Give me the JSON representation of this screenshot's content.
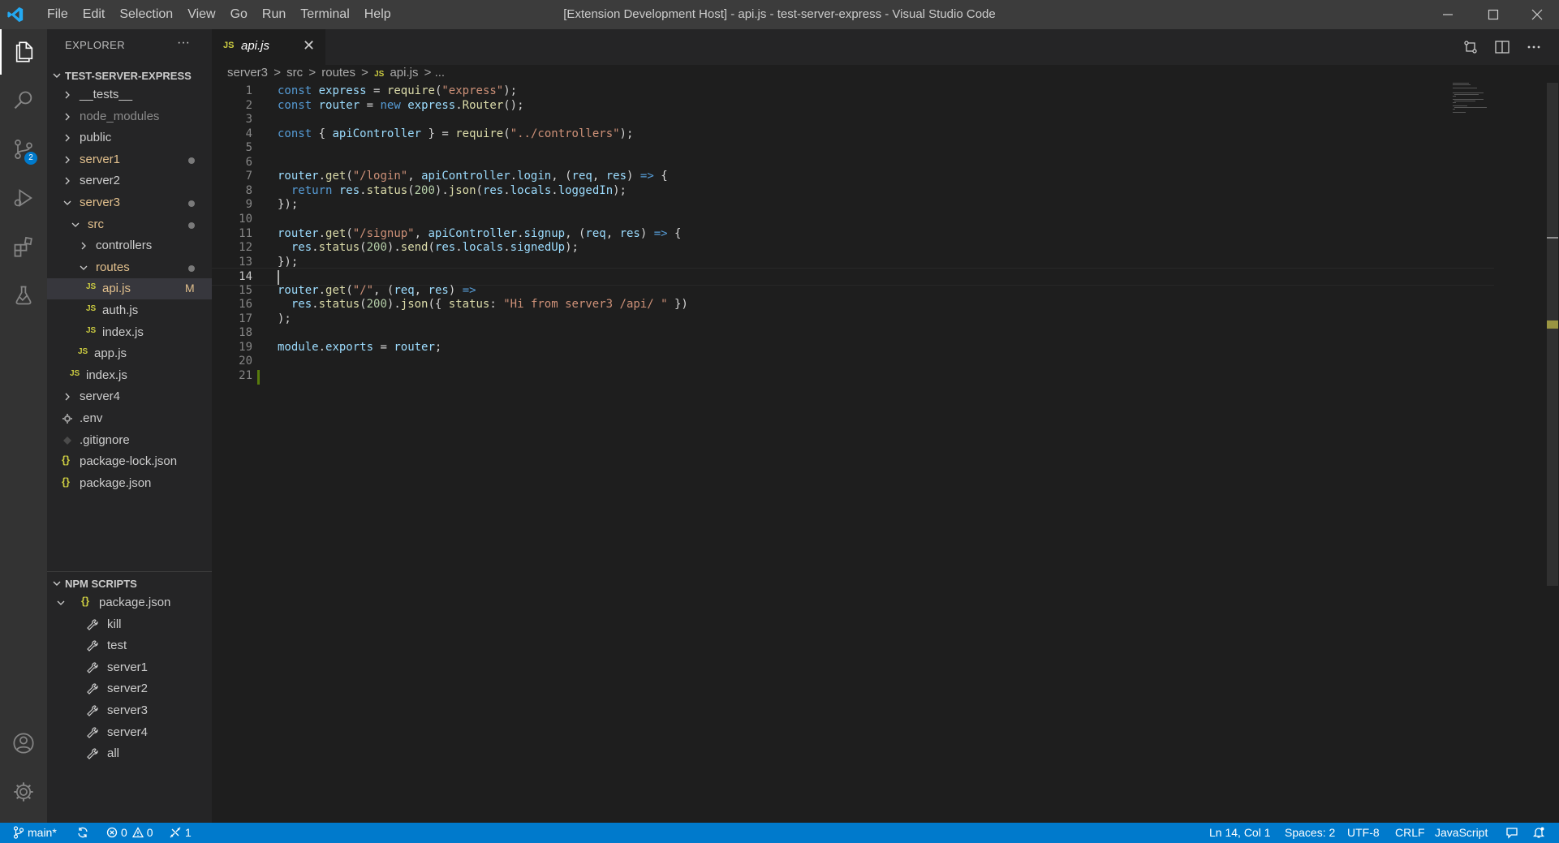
{
  "window": {
    "title": "[Extension Development Host] - api.js - test-server-express - Visual Studio Code",
    "menu": [
      "File",
      "Edit",
      "Selection",
      "View",
      "Go",
      "Run",
      "Terminal",
      "Help"
    ]
  },
  "activity_bar": {
    "scm_badge": "2",
    "items": [
      "explorer-icon",
      "search-icon",
      "source-control-icon",
      "run-debug-icon",
      "extensions-icon",
      "testing-icon",
      "account-icon",
      "settings-gear-icon"
    ]
  },
  "explorer": {
    "header": "EXPLORER",
    "more": "···",
    "root": "TEST-SERVER-EXPRESS",
    "items": [
      {
        "label": "__tests__",
        "kind": "folder"
      },
      {
        "label": "node_modules",
        "kind": "folder"
      },
      {
        "label": "public",
        "kind": "folder"
      },
      {
        "label": "server1",
        "kind": "folder"
      },
      {
        "label": "server2",
        "kind": "folder"
      },
      {
        "label": "server3",
        "kind": "folder"
      },
      {
        "label": "src",
        "kind": "folder"
      },
      {
        "label": "controllers",
        "kind": "folder"
      },
      {
        "label": "routes",
        "kind": "folder"
      },
      {
        "label": "api.js",
        "kind": "js",
        "badge": "M"
      },
      {
        "label": "auth.js",
        "kind": "js"
      },
      {
        "label": "index.js",
        "kind": "js"
      },
      {
        "label": "app.js",
        "kind": "js"
      },
      {
        "label": "index.js",
        "kind": "js"
      },
      {
        "label": "server4",
        "kind": "folder"
      },
      {
        "label": ".env",
        "kind": "gear"
      },
      {
        "label": ".gitignore",
        "kind": "diamond"
      },
      {
        "label": "package-lock.json",
        "kind": "json"
      },
      {
        "label": "package.json",
        "kind": "json"
      }
    ],
    "js_icon": "JS",
    "json_icon": "{}"
  },
  "npm_scripts": {
    "header": "NPM SCRIPTS",
    "package": "package.json",
    "scripts": [
      "kill",
      "test",
      "server1",
      "server2",
      "server3",
      "server4",
      "all"
    ]
  },
  "tab": {
    "icon": "JS",
    "name": "api.js",
    "close": "✕"
  },
  "breadcrumb": {
    "parts": [
      "server3",
      ">",
      "src",
      ">",
      "routes",
      ">"
    ],
    "js_icon": "JS",
    "file": "api.js",
    "tail": "> ..."
  },
  "editor": {
    "lines": [
      "const express = require(\"express\");",
      "const router = new express.Router();",
      "",
      "const { apiController } = require(\"../controllers\");",
      "",
      "",
      "router.get(\"/login\", apiController.login, (req, res) => {",
      "  return res.status(200).json(res.locals.loggedIn);",
      "});",
      "",
      "router.get(\"/signup\", apiController.signup, (req, res) => {",
      "  res.status(200).send(res.locals.signedUp);",
      "});",
      "",
      "router.get(\"/\", (req, res) =>",
      "  res.status(200).json({ status: \"Hi from server3 /api/ \" })",
      ");",
      "",
      "module.exports = router;",
      "",
      ""
    ],
    "current_line": 14
  },
  "status_bar": {
    "branch": "main*",
    "errors": "0",
    "warnings": "0",
    "ports": "1",
    "position": "Ln 14, Col 1",
    "spaces": "Spaces: 2",
    "encoding": "UTF-8",
    "eol": "CRLF",
    "language": "JavaScript"
  },
  "colors": {
    "accent": "#007acc",
    "modified": "#e2c08d",
    "js_icon": "#cbcb41",
    "json_icon": "#cbcb41"
  }
}
